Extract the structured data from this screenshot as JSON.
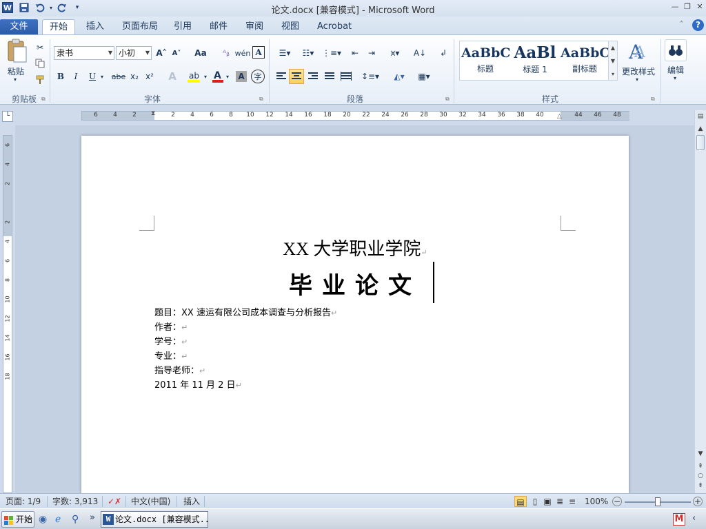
{
  "window": {
    "title": "论文.docx [兼容模式] - Microsoft Word"
  },
  "quick_access": {
    "app_icon": "W",
    "save": "save-icon",
    "undo": "undo-icon",
    "redo": "redo-icon"
  },
  "tabs": [
    {
      "label": "文件"
    },
    {
      "label": "开始"
    },
    {
      "label": "插入"
    },
    {
      "label": "页面布局"
    },
    {
      "label": "引用"
    },
    {
      "label": "邮件"
    },
    {
      "label": "审阅"
    },
    {
      "label": "视图"
    },
    {
      "label": "Acrobat"
    }
  ],
  "ribbon": {
    "clipboard": {
      "paste_label": "粘贴",
      "group_label": "剪贴板"
    },
    "font": {
      "font_name": "隶书",
      "font_size": "小初",
      "group_label": "字体",
      "bold": "B",
      "italic": "I",
      "underline": "U",
      "strike": "abe",
      "sub": "x₂",
      "sup": "x²",
      "grow": "A˄",
      "shrink": "A˅",
      "case": "Aa",
      "clear": "A"
    },
    "paragraph": {
      "group_label": "段落"
    },
    "styles": {
      "group_label": "样式",
      "items": [
        {
          "sample": "AaBbC",
          "label": "标题"
        },
        {
          "sample": "AaBl",
          "label": "标题 1"
        },
        {
          "sample": "AaBbC",
          "label": "副标题"
        }
      ],
      "change_label": "更改样式"
    },
    "editing": {
      "label": "编辑"
    }
  },
  "ruler": {
    "numbers": [
      "6",
      "4",
      "2",
      "2",
      "4",
      "6",
      "8",
      "10",
      "12",
      "14",
      "16",
      "18",
      "20",
      "22",
      "24",
      "26",
      "28",
      "30",
      "32",
      "34",
      "36",
      "38",
      "40",
      "44",
      "46",
      "48"
    ],
    "vnumbers": [
      "6",
      "4",
      "2",
      "2",
      "4",
      "6",
      "8",
      "10",
      "12",
      "14",
      "16",
      "18"
    ]
  },
  "document": {
    "line1": "XX 大学职业学院",
    "line2": "毕业论文",
    "fields": [
      "题目：XX 速运有限公司成本调查与分析报告",
      "作者：",
      "学号：",
      "专业：",
      "指导老师：",
      "2011 年 11 月 2 日"
    ],
    "pilcrow": "↵"
  },
  "status": {
    "page": "页面: 1/9",
    "words": "字数: 3,913",
    "language": "中文(中国)",
    "mode": "插入",
    "zoom": "100%"
  },
  "taskbar": {
    "start": "开始",
    "task": "论文.docx [兼容模式..."
  }
}
